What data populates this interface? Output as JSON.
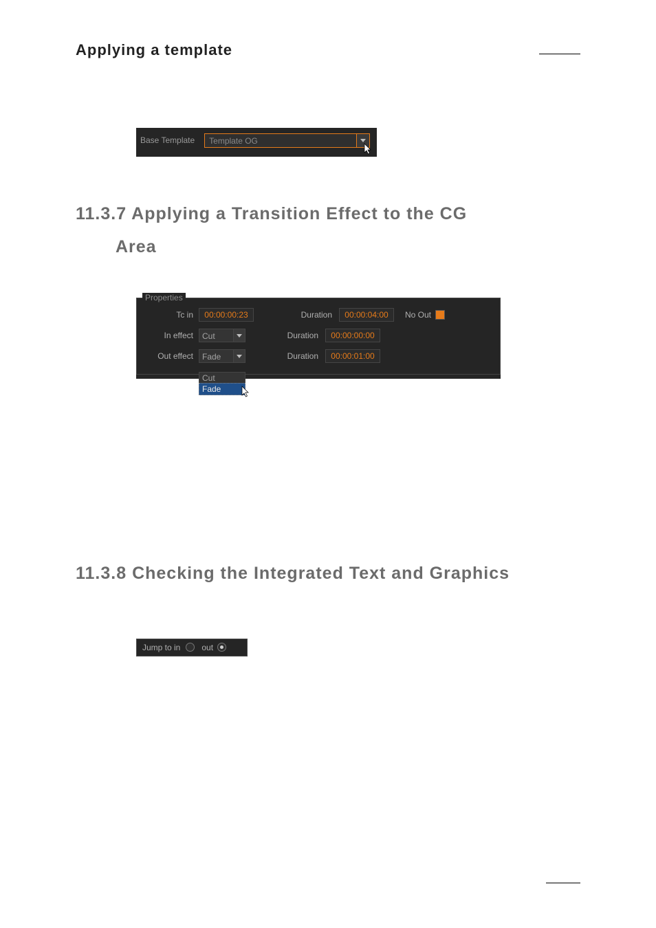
{
  "headings": {
    "applying_template": "Applying  a  template",
    "section_11_3_7_line1": "11.3.7 Applying  a  Transition  Effect  to  the  CG",
    "section_11_3_7_line2": "Area",
    "section_11_3_8": "11.3.8 Checking  the  Integrated  Text  and  Graphics"
  },
  "base_template": {
    "label": "Base Template",
    "value": "Template OG"
  },
  "properties": {
    "legend": "Properties",
    "tc_in_label": "Tc in",
    "tc_in_value": "00:00:00:23",
    "duration_label": "Duration",
    "duration_tc": "00:00:04:00",
    "no_out_label": "No Out",
    "in_effect_label": "In effect",
    "in_effect_value": "Cut",
    "in_effect_duration": "00:00:00:00",
    "out_effect_label": "Out effect",
    "out_effect_value": "Fade",
    "out_effect_duration": "00:00:01:00",
    "dropdown_options": {
      "opt1": "Cut",
      "opt2": "Fade"
    }
  },
  "jump": {
    "label": "Jump to in",
    "out_label": "out"
  }
}
